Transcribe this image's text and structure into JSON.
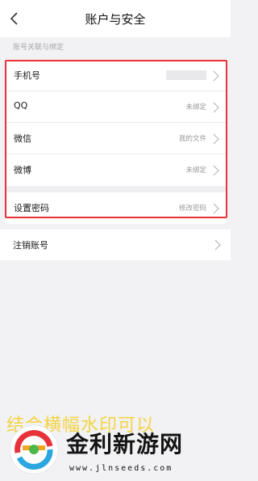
{
  "header": {
    "title": "账户与安全"
  },
  "section_label": "账号关联与绑定",
  "linked_rows": [
    {
      "label": "手机号",
      "value": ""
    },
    {
      "label": "QQ",
      "value": "未绑定"
    },
    {
      "label": "微信",
      "value": "我的文件"
    },
    {
      "label": "微博",
      "value": "未绑定"
    }
  ],
  "password_row": {
    "label": "设置密码",
    "value": "修改密码"
  },
  "cancel_row": {
    "label": "注销账号"
  },
  "watermark": {
    "caption": "结合横幅水印可以",
    "brand_name": "金利新游网",
    "url": "www.jlnseeds.com"
  },
  "colors": {
    "highlight_frame": "#e8323a",
    "watermark_caption": "#f4d23a"
  }
}
